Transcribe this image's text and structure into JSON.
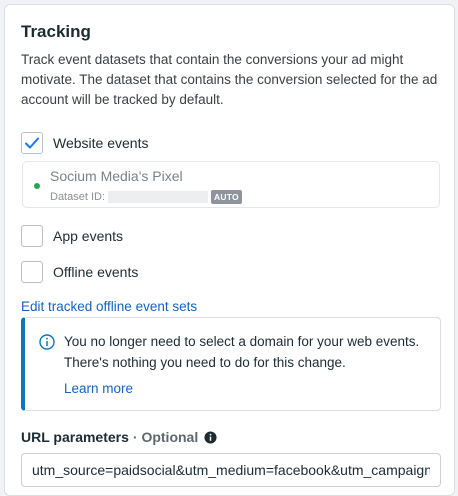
{
  "tracking": {
    "title": "Tracking",
    "description": "Track event datasets that contain the conversions your ad might motivate. The dataset that contains the conversion selected for the ad account will be tracked by default.",
    "website_events": {
      "label": "Website events",
      "checked": true
    },
    "dataset": {
      "name": "Socium Media's Pixel",
      "id_label": "Dataset ID:",
      "badge": "AUTO",
      "status_color": "#2ca44e"
    },
    "app_events": {
      "label": "App events",
      "checked": false
    },
    "offline_events": {
      "label": "Offline events",
      "checked": false
    },
    "edit_link": "Edit tracked offline event sets",
    "info": {
      "message": "You no longer need to select a domain for your web events. There's nothing you need to do for this change.",
      "learn_more": "Learn more",
      "accent_color": "#0a78be",
      "icon": "info-icon"
    },
    "url_parameters": {
      "label": "URL parameters",
      "optional": "· Optional",
      "help_icon": "info-filled-icon",
      "value": "utm_source=paidsocial&utm_medium=facebook&utm_campaign"
    }
  },
  "colors": {
    "link": "#1463c6",
    "check": "#1877f2",
    "text": "#1c2b33"
  }
}
